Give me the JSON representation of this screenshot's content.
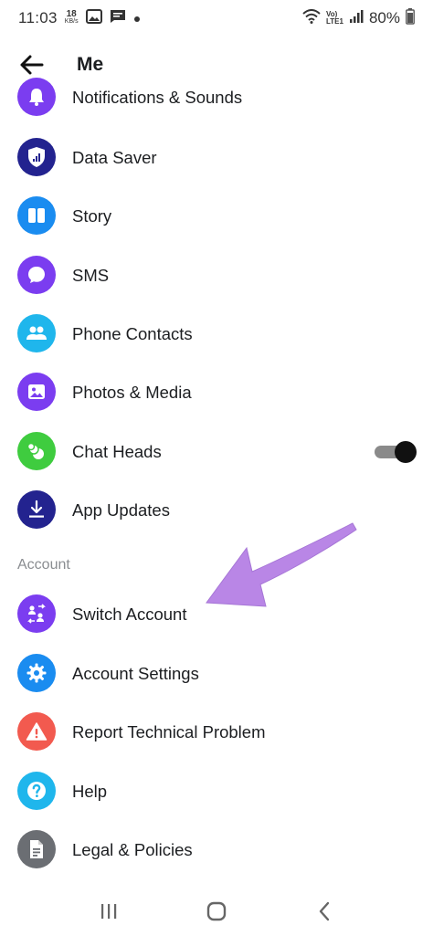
{
  "status_bar": {
    "time": "11:03",
    "data_speed": "18",
    "data_unit": "KB/s",
    "network_label_top": "Vo)",
    "network_label_bottom": "LTE1",
    "battery": "80%"
  },
  "header": {
    "title": "Me"
  },
  "items": [
    {
      "label": "Notifications & Sounds",
      "icon": "bell-icon",
      "color": "#7b3df0"
    },
    {
      "label": "Data Saver",
      "icon": "shield-signal-icon",
      "color": "#23238f"
    },
    {
      "label": "Story",
      "icon": "story-icon",
      "color": "#1a8cf0"
    },
    {
      "label": "SMS",
      "icon": "chat-bubble-icon",
      "color": "#7b3df0"
    },
    {
      "label": "Phone Contacts",
      "icon": "people-icon",
      "color": "#1fb6ec"
    },
    {
      "label": "Photos & Media",
      "icon": "photo-icon",
      "color": "#7b3df0"
    },
    {
      "label": "Chat Heads",
      "icon": "chat-heads-icon",
      "color": "#3fcc3f"
    },
    {
      "label": "App Updates",
      "icon": "download-icon",
      "color": "#23238f"
    }
  ],
  "account_section": {
    "header": "Account",
    "items": [
      {
        "label": "Switch Account",
        "icon": "switch-account-icon",
        "color": "#7b3df0"
      },
      {
        "label": "Account Settings",
        "icon": "gear-icon",
        "color": "#1a8cf0"
      },
      {
        "label": "Report Technical Problem",
        "icon": "warning-icon",
        "color": "#f25a4f"
      },
      {
        "label": "Help",
        "icon": "question-icon",
        "color": "#1fb6ec"
      },
      {
        "label": "Legal & Policies",
        "icon": "document-icon",
        "color": "#6b6e73"
      }
    ]
  },
  "chat_heads_toggle": {
    "on": true
  },
  "annotation_arrow_color": "#b986e6"
}
